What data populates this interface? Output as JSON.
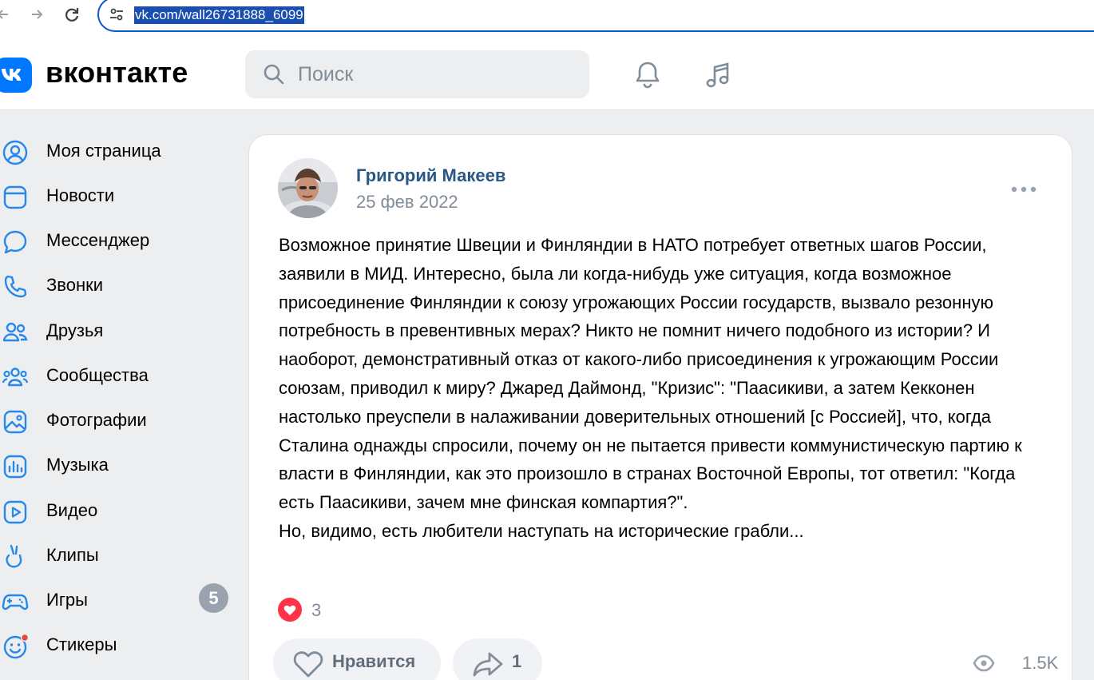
{
  "browser": {
    "url": "vk.com/wall26731888_6099"
  },
  "header": {
    "wordmark": "вконтакте",
    "search_placeholder": "Поиск"
  },
  "sidebar": {
    "items": [
      {
        "label": "Моя страница",
        "icon": "user-circle-icon"
      },
      {
        "label": "Новости",
        "icon": "news-icon"
      },
      {
        "label": "Мессенджер",
        "icon": "message-icon"
      },
      {
        "label": "Звонки",
        "icon": "phone-icon"
      },
      {
        "label": "Друзья",
        "icon": "friends-icon"
      },
      {
        "label": "Сообщества",
        "icon": "communities-icon"
      },
      {
        "label": "Фотографии",
        "icon": "photo-icon"
      },
      {
        "label": "Музыка",
        "icon": "music-icon"
      },
      {
        "label": "Видео",
        "icon": "video-icon"
      },
      {
        "label": "Клипы",
        "icon": "clips-icon"
      },
      {
        "label": "Игры",
        "icon": "games-icon",
        "badge": "5"
      },
      {
        "label": "Стикеры",
        "icon": "stickers-icon"
      }
    ]
  },
  "post": {
    "author": "Григорий Макеев",
    "date": "25 фев 2022",
    "text": "Возможное принятие Швеции и Финляндии в НАТО потребует ответных шагов России, заявили в МИД. Интересно, была ли когда-нибудь уже ситуация, когда возможное присоединение Финляндии к союзу угрожающих России государств, вызвало резонную потребность в превентивных мерах? Никто не помнит ничего подобного из истории? И наоборот, демонстративный отказ от какого-либо присоединения к угрожающим России союзам, приводил к миру? Джаред Даймонд, \"Кризис\": \"Паасикиви, а затем Кекконен настолько преуспели в налаживании доверительных отношений [с Россией], что, когда Сталина однажды спросили, почему он не пытается привести коммунистическую партию к власти в Финляндии, как это произошло в странах Восточной Европы, тот ответил: \"Когда есть Паасикиви, зачем мне финская компартия?\".\nНо, видимо, есть любители наступать на исторические грабли...",
    "reaction_count": "3",
    "like_label": "Нравится",
    "share_count": "1",
    "views": "1.5K"
  },
  "colors": {
    "vk_blue": "#0077ff",
    "link_blue": "#2a5885",
    "muted": "#818c99",
    "like_red": "#ff3347",
    "page_bg": "#edeef0"
  }
}
